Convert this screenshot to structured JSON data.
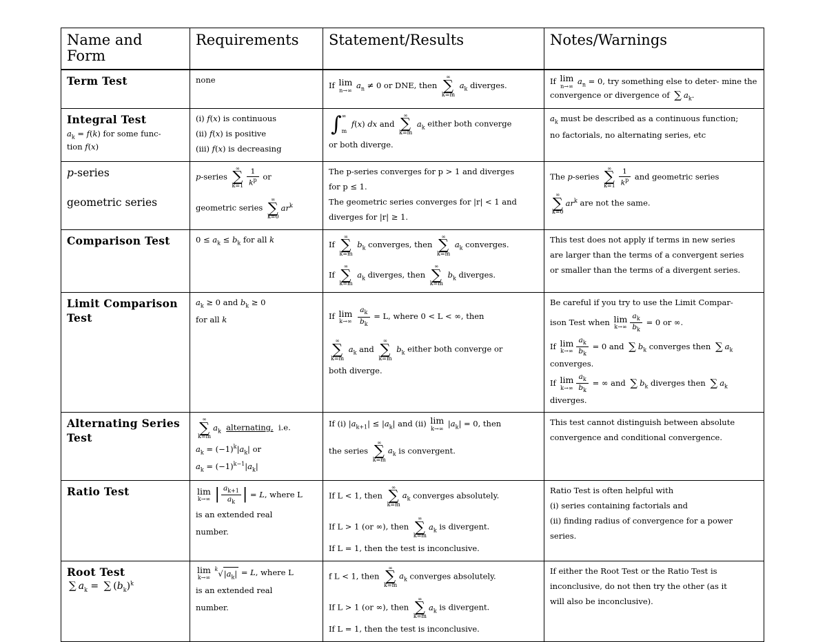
{
  "document": {
    "type": "series-convergence-tests-reference-table",
    "headers": {
      "col1": "Name and Form",
      "col2": "Requirements",
      "col3": "Statement/Results",
      "col4": "Notes/Warnings"
    }
  },
  "rows": [
    {
      "id": "term-test",
      "name": {
        "title": "Term Test",
        "sub": ""
      },
      "requirements_text": "none",
      "statement_text": "If lim(n→∞) a_n ≠ 0 or DNE, then sum(k=m to ∞) a_k diverges.",
      "notes_text": "If lim(n→∞) a_n = 0, try something else to determine the convergence or divergence of Σ a_k."
    },
    {
      "id": "integral-test",
      "name": {
        "title": "Integral Test",
        "sub": "a_k = f(k) for some function f(x)"
      },
      "requirements_text": "(i) f(x) is continuous  (ii) f(x) is positive  (iii) f(x) is decreasing",
      "statement_text": "∫(m to ∞) f(x) dx and sum(k=m to ∞) a_k either both converge or both diverge.",
      "notes_text": "a_k must be described as a continuous function; no factorials, no alternating series, etc"
    },
    {
      "id": "p-series-geometric-series",
      "name": {
        "title": "p-series",
        "title2": "geometric series"
      },
      "requirements_text": "p-series sum(k=1 to ∞) 1/k^p or geometric series sum(k=0 to ∞) a r^k",
      "statement_text": "The p-series converges for p > 1 and diverges for p ≤ 1. The geometric series converges for |r| < 1 and diverges for |r| ≥ 1.",
      "notes_text": "The p-series sum(k=1 to ∞) 1/k^p and geometric series sum(k=0 to ∞) a r^k are not the same."
    },
    {
      "id": "comparison-test",
      "name": {
        "title": "Comparison Test",
        "sub": ""
      },
      "requirements_text": "0 ≤ a_k ≤ b_k for all k",
      "statement_text": "If sum(k=m to ∞) b_k converges, then sum(k=m to ∞) a_k converges. If sum(k=m to ∞) a_k diverges, then sum(k=m to ∞) b_k diverges.",
      "notes_text": "This test does not apply if terms in new series are larger than the terms of a convergent series or smaller than the terms of a divergent series."
    },
    {
      "id": "limit-comparison-test",
      "name": {
        "title": "Limit Comparison Test",
        "sub": ""
      },
      "requirements_text": "a_k ≥ 0 and b_k ≥ 0 for all k",
      "statement_text": "If lim(k→∞) a_k/b_k = L, where 0 < L < ∞, then sum(k=m to ∞) a_k and sum(k=m to ∞) b_k either both converge or both diverge.",
      "notes_text": "Be careful if you try to use the Limit Comparison Test when lim(k→∞) a_k/b_k = 0 or ∞. If lim(k→∞) a_k/b_k = 0 and Σ b_k converges then Σ a_k converges. If lim(k→∞) a_k/b_k = ∞ and Σ b_k diverges then Σ a_k diverges."
    },
    {
      "id": "alternating-series-test",
      "name": {
        "title": "Alternating Series Test",
        "sub": ""
      },
      "requirements_text": "sum(k=m to ∞) a_k alternating, i.e. a_k = (−1)^k |a_k| or a_k = (−1)^(k−1) |a_k|",
      "statement_text": "If (i) |a_(k+1)| ≤ |a_k| and (ii) lim(k→∞) |a_k| = 0, then the series sum(k=m to ∞) a_k is convergent.",
      "notes_text": "This test cannot distinguish between absolute convergence and conditional convergence."
    },
    {
      "id": "ratio-test",
      "name": {
        "title": "Ratio Test",
        "sub": ""
      },
      "requirements_text": "lim(k→∞) |a_(k+1)/a_k| = L, where L is an extended real number.",
      "statement_text": "If L < 1, then sum(k=m to ∞) a_k converges absolutely. If L > 1 (or ∞), then sum(k=m to ∞) a_k is divergent. If L = 1, then the test is inconclusive.",
      "notes_text": "Ratio Test is often helpful with (i) series containing factorials and (ii) finding radius of convergence for a power series."
    },
    {
      "id": "root-test",
      "name": {
        "title": "Root Test",
        "sub": "Σ a_k = Σ (b_k)^k"
      },
      "requirements_text": "lim(k→∞) k-th-root(|a_k|) = L, where L is an extended real number.",
      "statement_text": "f L < 1, then sum(k=m to ∞) a_k converges absolutely. If L > 1 (or ∞), then sum(k=m to ∞) a_k is divergent. If L = 1, then the test is inconclusive.",
      "notes_text": "If either the Root Test or the Ratio Test is inconclusive, do not then try the other (as it will also be inconclusive)."
    }
  ],
  "labels": {
    "none": "none",
    "req_integral_i": "(i) f(x) is continuous",
    "req_integral_ii": "(ii) f(x) is positive",
    "req_integral_iii": "(iii) f(x) is decreasing",
    "pseries_word": "p-series",
    "geometric_word": "geometric series",
    "or_word": "or",
    "alternating_word": "alternating,",
    "ie_word": "i.e.",
    "where_L": ", where L",
    "extended_real": "is an extended real",
    "number_word": "number.",
    "for_all_k": "for all k",
    "diverges_word": "diverges.",
    "converges_word": "converges.",
    "if_word": "If",
    "then_word": "then",
    "and_word": "and",
    "or_both_diverge": "or both diverge.",
    "both_diverge": "both diverge.",
    "either_both_converge": "either both converge",
    "either_both_converge_or": "either both converge or",
    "is_convergent": "is convergent.",
    "the_series": "the series",
    "converges_absolutely": "converges absolutely.",
    "is_divergent": "is divergent.",
    "inconclusive_line": "then the test is inconclusive.",
    "or_infinity": "(or ∞), then",
    "term_notes_2": "mine the convergence or divergence of",
    "term_notes_1a": "try something else to deter-",
    "integral_notes_1": "a",
    "integral_notes_1b": " must be described as a continuous function;",
    "integral_notes_2": "no factorials, no alternating series, etc",
    "pseries_stmt_1a": "The p-series converges for p > 1 and diverges",
    "pseries_stmt_1b": "for p ≤ 1.",
    "pseries_stmt_2a": "The geometric series converges for |r| < 1 and",
    "pseries_stmt_2b": "diverges for |r| ≥ 1.",
    "pseries_notes_1": "The",
    "pseries_notes_2": "and  geometric  series",
    "pseries_notes_3": "are not the same.",
    "comparison_notes_1": "This test does not apply if terms in new series",
    "comparison_notes_2": "are larger than the terms of a convergent series",
    "comparison_notes_3": "or smaller than the terms of a divergent series.",
    "lct_notes_1": "Be careful if you try to use the Limit Compar-",
    "lct_notes_2": "ison Test when",
    "lct_notes_3": "= 0 or ∞.",
    "lct_notes_4": "= 0 and",
    "lct_notes_5": "converges then",
    "lct_notes_6": "converges.",
    "lct_notes_7": "= ∞ and",
    "lct_notes_8": "diverges then",
    "lct_notes_9": "diverges.",
    "ast_notes_1": "This test cannot distinguish between absolute",
    "ast_notes_2": "convergence and conditional convergence.",
    "ratio_notes_1": "Ratio Test is often helpful with",
    "ratio_notes_2": "(i) series containing factorials and",
    "ratio_notes_3": "(ii) finding radius of convergence for a power",
    "ratio_notes_4": "series.",
    "root_notes_1": "If either the Root Test or the Ratio Test is",
    "root_notes_2": "inconclusive, do not then try the other (as it",
    "root_notes_3": "will also be inconclusive).",
    "lct_req_1": "a_k ≥ 0 and b_k ≥ 0",
    "comparison_req": "0 ≤ a_k ≤ b_k for all k",
    "integral_name_sub1": "a",
    "term_if": "If",
    "dne_clause": "≠ 0 or DNE, then",
    "eq0_clause": "= 0,",
    "where_0LT": "= L, where 0 < L < ∞, then",
    "ast_stmt_1": "If (i) |a",
    "root_f": "f L < 1, then",
    "if_L_lt_1": "If L < 1, then",
    "if_L_gt_1": "If L > 1",
    "if_L_eq_1": "If L = 1,"
  }
}
